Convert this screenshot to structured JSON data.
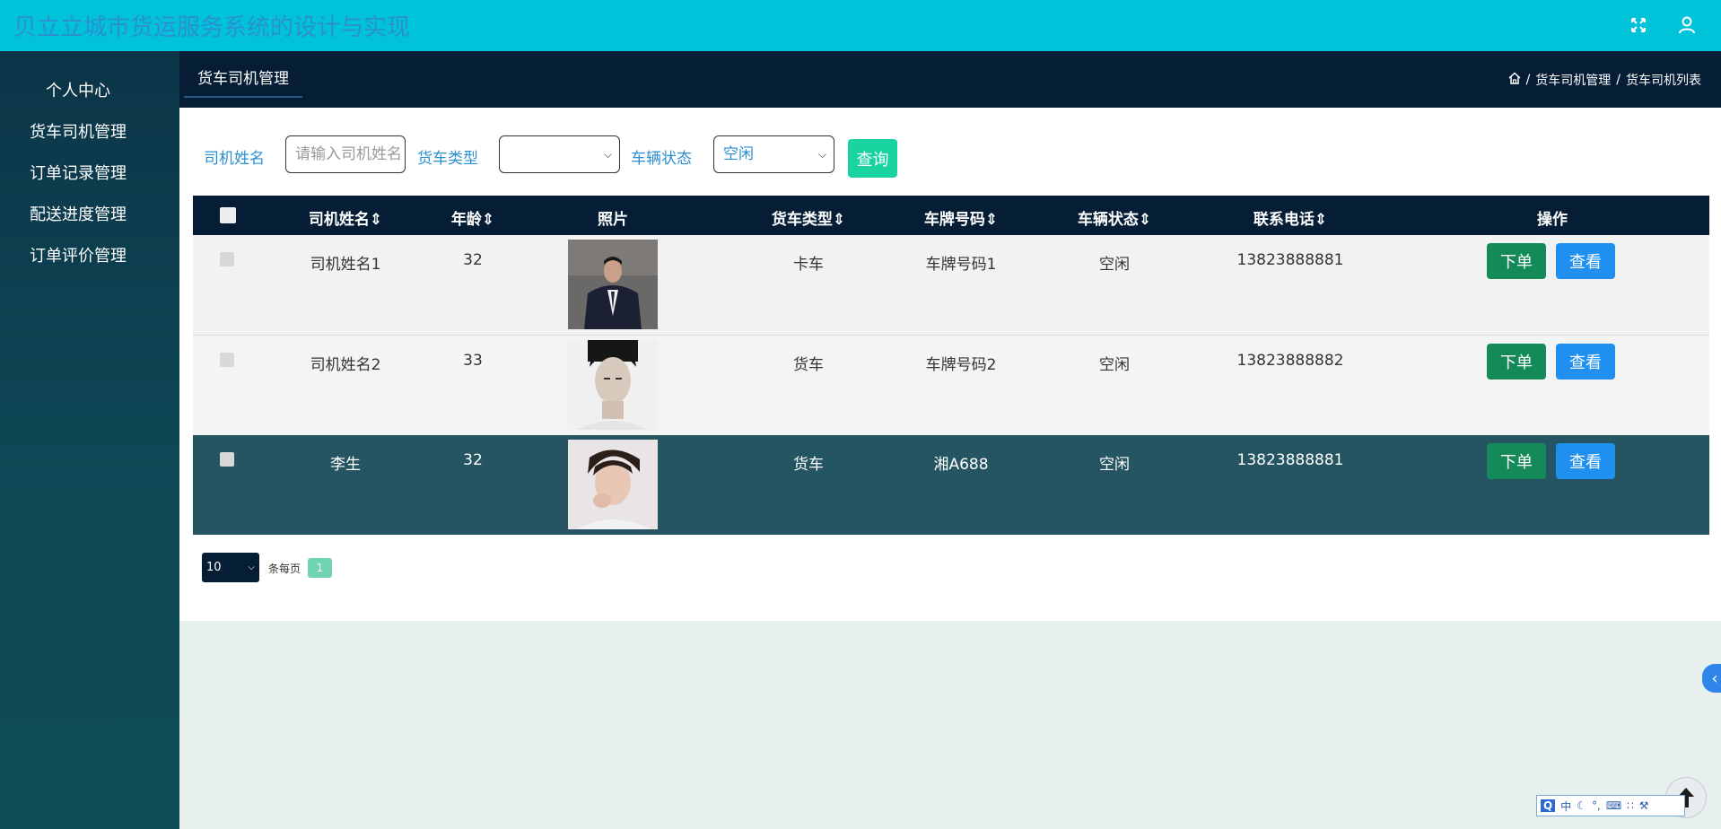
{
  "app": {
    "title": "贝立立城市货运服务系统的设计与实现",
    "icons": [
      "fullscreen-icon",
      "user-icon"
    ]
  },
  "colors": {
    "topbar": "#00c2d9",
    "header": "#051e36",
    "query_button": "#19d3a1",
    "order_button": "#148a59",
    "view_button": "#1f8ff0",
    "selected_row": "#255563"
  },
  "sidebar": {
    "items": [
      {
        "label": "个人中心"
      },
      {
        "label": "货车司机管理"
      },
      {
        "label": "订单记录管理"
      },
      {
        "label": "配送进度管理"
      },
      {
        "label": "订单评价管理"
      }
    ]
  },
  "header": {
    "tab": "货车司机管理",
    "breadcrumb": [
      "货车司机管理",
      "货车司机列表"
    ]
  },
  "search": {
    "driver_name_label": "司机姓名",
    "driver_name_placeholder": "请输入司机姓名",
    "truck_type_label": "货车类型",
    "truck_type_value": "",
    "vehicle_status_label": "车辆状态",
    "vehicle_status_value": "空闲",
    "query_label": "查询"
  },
  "table": {
    "headers": {
      "name": "司机姓名",
      "age": "年龄",
      "photo": "照片",
      "truck_type": "货车类型",
      "plate": "车牌号码",
      "status": "车辆状态",
      "phone": "联系电话",
      "actions": "操作"
    },
    "rows": [
      {
        "name": "司机姓名1",
        "age": "32",
        "truck_type": "卡车",
        "plate": "车牌号码1",
        "status": "空闲",
        "phone": "13823888881",
        "order": "下单",
        "view": "查看"
      },
      {
        "name": "司机姓名2",
        "age": "33",
        "truck_type": "货车",
        "plate": "车牌号码2",
        "status": "空闲",
        "phone": "13823888882",
        "order": "下单",
        "view": "查看"
      },
      {
        "name": "李生",
        "age": "32",
        "truck_type": "货车",
        "plate": "湘A688",
        "status": "空闲",
        "phone": "13823888881",
        "order": "下单",
        "view": "查看"
      }
    ]
  },
  "pagination": {
    "page_size": "10",
    "per_page_label": "条每页",
    "current_page": "1"
  },
  "ime": {
    "mode": "中"
  }
}
